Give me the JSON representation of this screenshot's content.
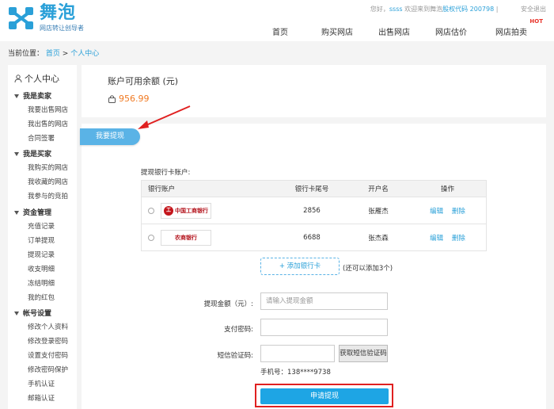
{
  "header": {
    "logo_name": "舞泡",
    "logo_slogan": "网店转让创导者",
    "greeting_prefix": "您好，",
    "username": "ssss",
    "greeting_mid": "欢迎来到舞泡",
    "stock_code": "股权代码 200798",
    "greeting_suffix": "|",
    "logout": "安全退出",
    "nav": [
      {
        "label": "首页"
      },
      {
        "label": "购买网店"
      },
      {
        "label": "出售网店"
      },
      {
        "label": "网店估价"
      },
      {
        "label": "网店拍卖",
        "badge": "HOT"
      }
    ]
  },
  "breadcrumb": {
    "prefix": "当前位置：",
    "home": "首页",
    "sep": ">",
    "current": "个人中心"
  },
  "sidebar": {
    "title": "个人中心",
    "groups": [
      {
        "label": "我是卖家",
        "items": [
          "我要出售网店",
          "我出售的网店",
          "合同签署"
        ]
      },
      {
        "label": "我是买家",
        "items": [
          "我购买的网店",
          "我收藏的网店",
          "我参与的竞拍"
        ]
      },
      {
        "label": "资金管理",
        "items": [
          "充值记录",
          "订单提现",
          "提现记录",
          "收支明细",
          "冻结明细",
          "我的红包"
        ]
      },
      {
        "label": "帐号设置",
        "items": [
          "修改个人资料",
          "修改登录密码",
          "设置支付密码",
          "修改密码保护",
          "手机认证",
          "邮箱认证"
        ]
      }
    ]
  },
  "balance": {
    "label": "账户可用余额 (元)",
    "value": "956.99"
  },
  "withdraw_tab": "我要提现",
  "accounts": {
    "label": "提现银行卡账户:",
    "headers": [
      "银行账户",
      "银行卡尾号",
      "开户名",
      "操作"
    ],
    "rows": [
      {
        "bank": "中国工商银行",
        "tail": "2856",
        "holder": "张雁杰",
        "edit": "编辑",
        "delete": "删除"
      },
      {
        "bank": "农商银行",
        "tail": "6688",
        "holder": "张杰森",
        "edit": "编辑",
        "delete": "删除"
      }
    ]
  },
  "add_card": {
    "label": "+ 添加银行卡",
    "hint": "(还可以添加3个)"
  },
  "form": {
    "amount_label": "提现金额（元）:",
    "amount_placeholder": "请输入提现金额",
    "paypwd_label": "支付密码:",
    "sms_label": "短信验证码:",
    "sms_button": "获取短信验证码",
    "phone_line": "手机号：138****9738"
  },
  "submit": "申请提现"
}
